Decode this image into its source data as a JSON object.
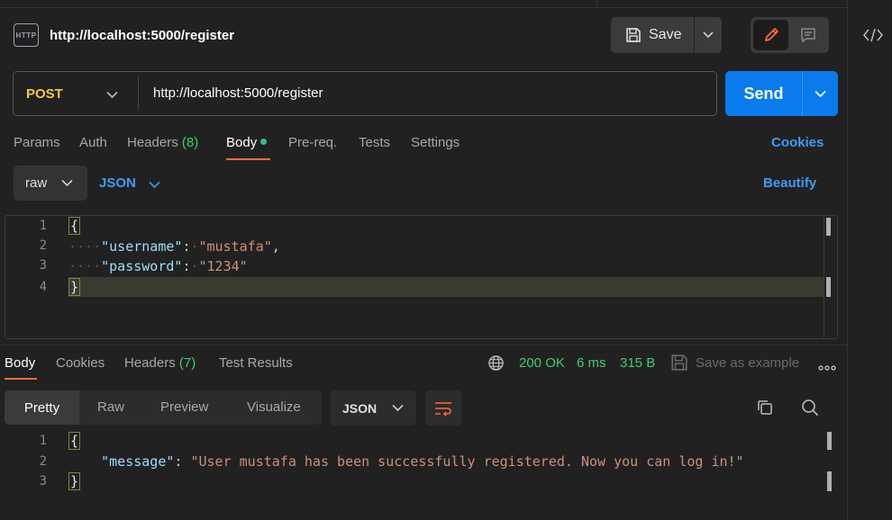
{
  "request": {
    "title": "http://localhost:5000/register",
    "method": "POST",
    "url": "http://localhost:5000/register"
  },
  "toolbar": {
    "save_label": "Save",
    "send_label": "Send"
  },
  "tabs": [
    {
      "label": "Params"
    },
    {
      "label": "Auth"
    },
    {
      "label": "Headers",
      "count": "(8)"
    },
    {
      "label": "Body"
    },
    {
      "label": "Pre-req."
    },
    {
      "label": "Tests"
    },
    {
      "label": "Settings"
    }
  ],
  "cookies_label": "Cookies",
  "body_options": {
    "mode": "raw",
    "language": "JSON",
    "beautify_label": "Beautify"
  },
  "request_body": {
    "line_numbers": [
      "1",
      "2",
      "3",
      "4"
    ],
    "open_brace": "{",
    "close_brace": "}",
    "key1": "\"username\"",
    "val1": "\"mustafa\"",
    "key2": "\"password\"",
    "val2": "\"1234\""
  },
  "response_tabs": [
    {
      "label": "Body"
    },
    {
      "label": "Cookies"
    },
    {
      "label": "Headers",
      "count": "(7)"
    },
    {
      "label": "Test Results"
    }
  ],
  "response_status": {
    "status": "200 OK",
    "time": "6 ms",
    "size": "315 B",
    "save_example_label": "Save as example"
  },
  "view_options": {
    "pretty": "Pretty",
    "raw": "Raw",
    "preview": "Preview",
    "visualize": "Visualize",
    "format": "JSON"
  },
  "response_body": {
    "line_numbers": [
      "1",
      "2",
      "3"
    ],
    "open_brace": "{",
    "close_brace": "}",
    "key": "\"message\"",
    "value": "\"User mustafa has been successfully registered. Now you can log in!\""
  },
  "colors": {
    "accent_blue": "#097bed",
    "link_blue": "#3d9bf5",
    "method_yellow": "#f5c842",
    "status_green": "#3ccf6c",
    "tab_underline": "#ff6c37"
  }
}
